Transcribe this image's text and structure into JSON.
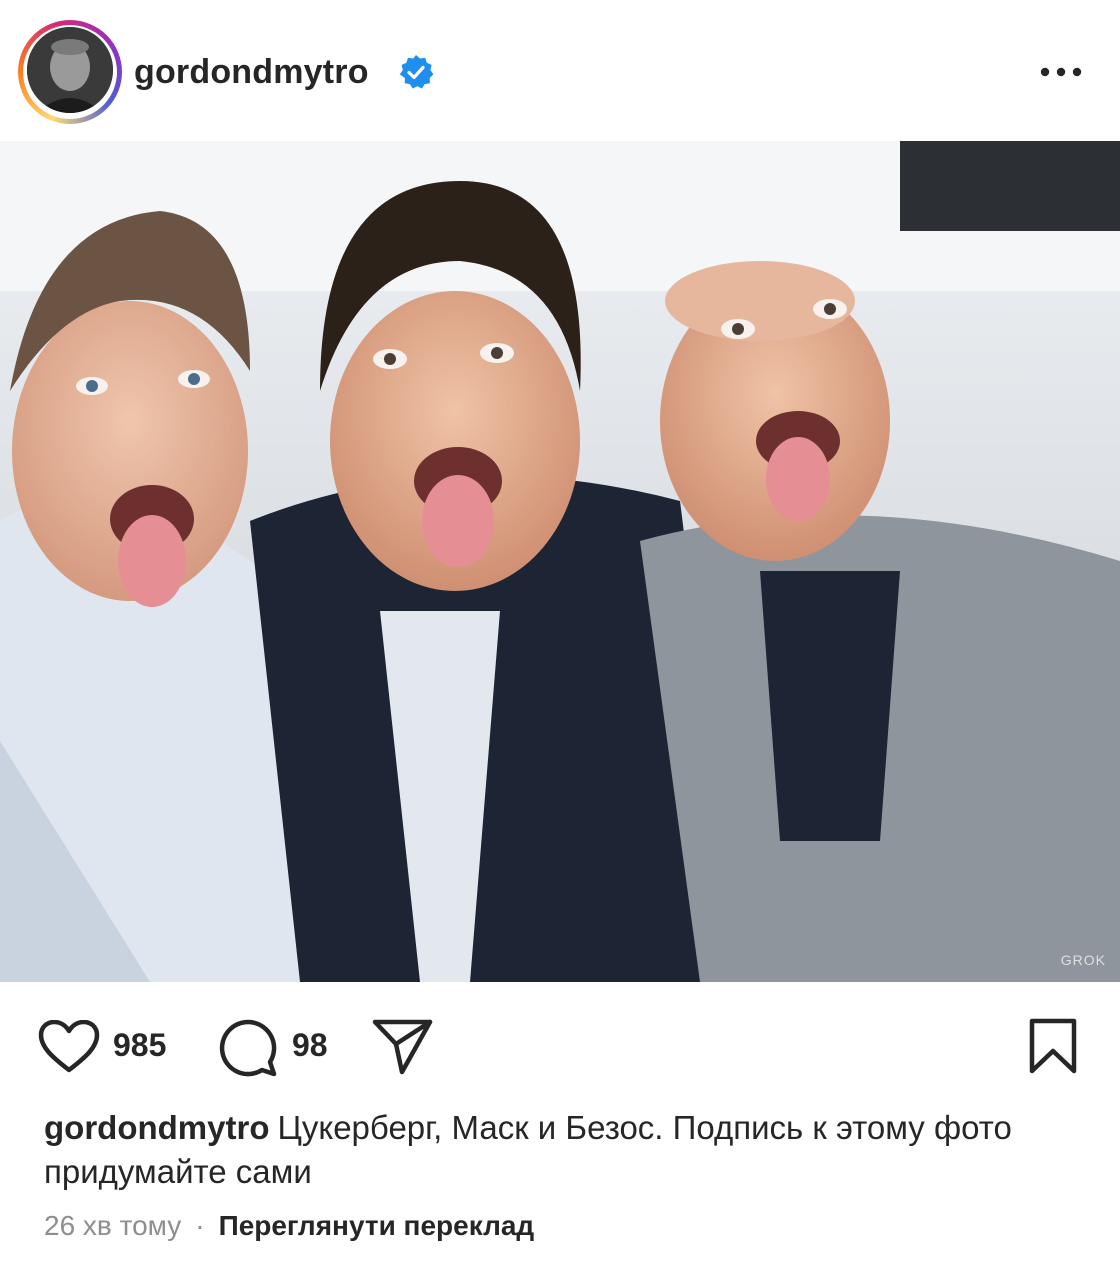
{
  "post": {
    "username": "gordondmytro",
    "verified": true,
    "more_icon": "more-horizontal-icon",
    "photo_watermark": "GROK",
    "likes": "985",
    "comments": "98",
    "caption_user": "gordondmytro",
    "caption_text": "Цукерберг, Маск и Безос. Подпись к этому фото придумайте сами",
    "time_ago": "26 хв тому",
    "separator": "·",
    "translate_label": "Переглянути переклад"
  },
  "icons": {
    "like": "heart-icon",
    "comment": "comment-icon",
    "share": "paper-plane-icon",
    "save": "bookmark-icon",
    "verified": "verified-badge-icon"
  },
  "colors": {
    "verified_blue": "#1f8ef1",
    "text": "#262626",
    "muted": "#8e8e8e"
  }
}
